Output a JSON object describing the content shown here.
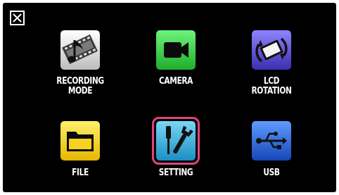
{
  "menu": {
    "close_icon": "close-x-icon",
    "items": [
      {
        "id": "recording-mode",
        "lines": [
          "RECORDING",
          "MODE"
        ],
        "icon": "film-music-note-icon",
        "color": "#e8e8e8"
      },
      {
        "id": "camera",
        "lines": [
          "CAMERA",
          ""
        ],
        "icon": "video-camera-icon",
        "color": "#2ecc40"
      },
      {
        "id": "lcd-rotation",
        "lines": [
          "LCD",
          "ROTATION"
        ],
        "icon": "rotate-screen-icon",
        "color": "#4b3fbf"
      },
      {
        "id": "file",
        "lines": [
          "FILE",
          ""
        ],
        "icon": "folder-icon",
        "color": "#f2d11a"
      },
      {
        "id": "setting",
        "lines": [
          "SETTING",
          ""
        ],
        "icon": "wrench-screwdriver-icon",
        "color": "#29a9d9",
        "selected": true
      },
      {
        "id": "usb",
        "lines": [
          "USB",
          ""
        ],
        "icon": "usb-icon",
        "color": "#1d5fd6"
      }
    ],
    "selection_color": "#e0437e"
  }
}
